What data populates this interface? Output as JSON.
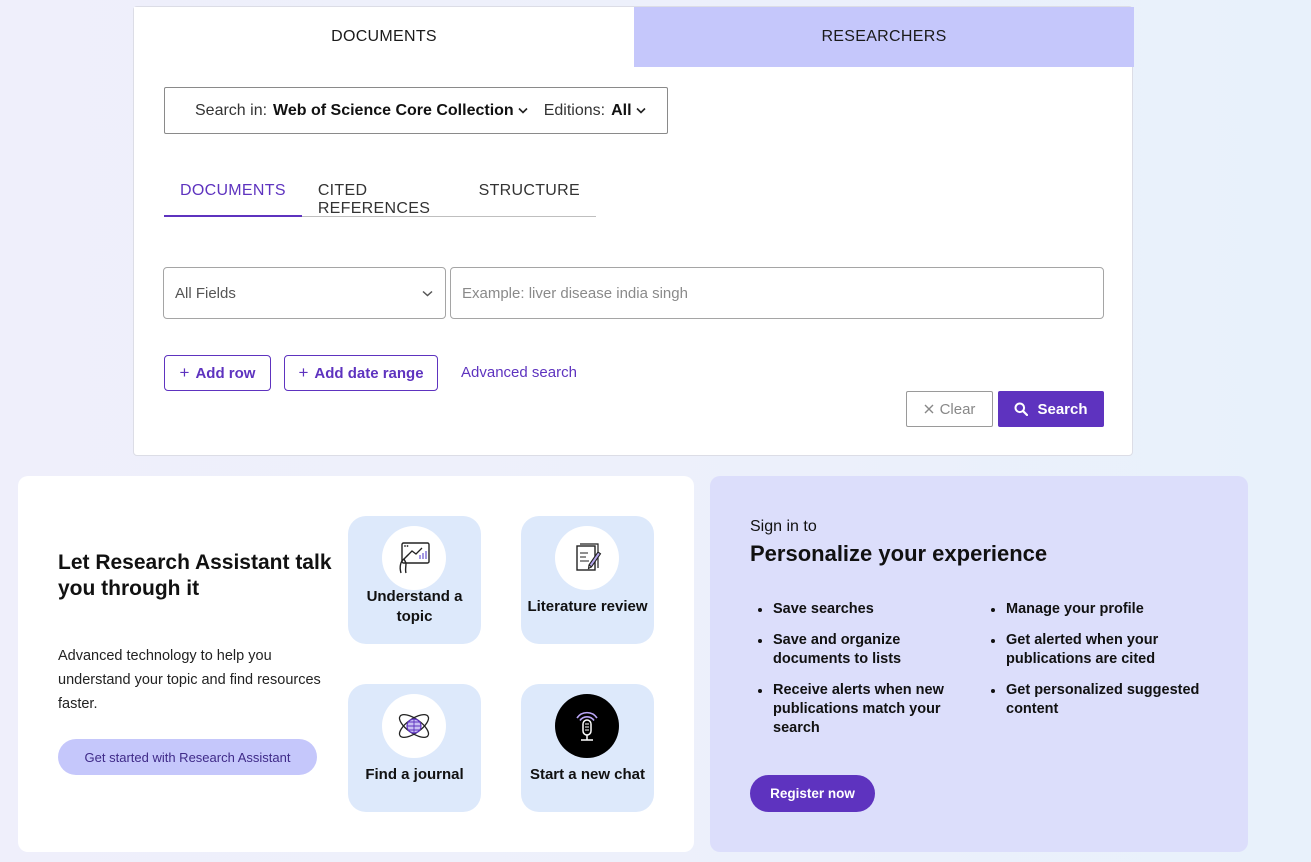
{
  "search": {
    "top_tabs": [
      {
        "label": "DOCUMENTS",
        "active": true
      },
      {
        "label": "RESEARCHERS",
        "active": false
      }
    ],
    "search_in_label": "Search in:",
    "collection": "Web of Science Core Collection",
    "editions_label": "Editions:",
    "editions_value": "All",
    "sub_tabs": [
      {
        "label": "DOCUMENTS",
        "active": true
      },
      {
        "label": "CITED REFERENCES",
        "active": false
      },
      {
        "label": "STRUCTURE",
        "active": false
      }
    ],
    "field_select": "All Fields",
    "query_placeholder": "Example: liver disease india singh",
    "add_row_label": "Add row",
    "add_date_label": "Add date range",
    "advanced_link": "Advanced search",
    "clear_label": "Clear",
    "search_label": "Search"
  },
  "assistant": {
    "title": "Let Research Assistant talk you through it",
    "description": "Advanced technology to help you understand your topic and find resources faster.",
    "cta": "Get started with Research Assistant",
    "tiles": [
      {
        "label": "Understand a topic",
        "icon": "topic-board-icon"
      },
      {
        "label": "Literature review",
        "icon": "document-pen-icon"
      },
      {
        "label": "Find a journal",
        "icon": "atom-globe-icon"
      },
      {
        "label": "Start a new chat",
        "icon": "microphone-icon"
      }
    ]
  },
  "signin": {
    "kicker": "Sign in to",
    "title": "Personalize your experience",
    "benefits_left": [
      "Save searches",
      "Save and organize documents to lists",
      "Receive alerts when new publications match your search"
    ],
    "benefits_right": [
      "Manage your profile",
      "Get alerted when your publications are cited",
      "Get personalized suggested content"
    ],
    "register": "Register now"
  },
  "colors": {
    "accent": "#5e33bf",
    "tab_inactive": "#c5c7fb",
    "tile_bg": "#dde9fb",
    "signin_bg": "#dcdefb"
  }
}
